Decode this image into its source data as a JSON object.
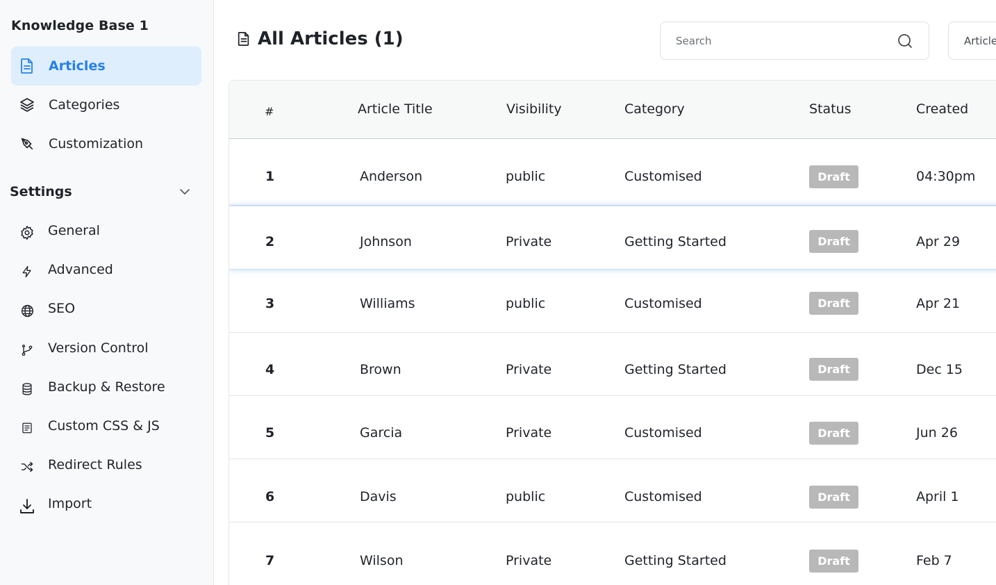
{
  "sidebar": {
    "kb_title": "Knowledge Base 1",
    "nav": [
      {
        "label": "Articles",
        "icon": "document-icon",
        "active": true
      },
      {
        "label": "Categories",
        "icon": "layers-icon",
        "active": false
      },
      {
        "label": "Customization",
        "icon": "pen-tool-icon",
        "active": false
      }
    ],
    "settings_label": "Settings",
    "settings_items": [
      {
        "label": "General",
        "icon": "gear-icon"
      },
      {
        "label": "Advanced",
        "icon": "lightning-icon"
      },
      {
        "label": "SEO",
        "icon": "globe-icon"
      },
      {
        "label": "Version Control",
        "icon": "git-branch-icon"
      },
      {
        "label": "Backup & Restore",
        "icon": "database-icon"
      },
      {
        "label": "Custom CSS & JS",
        "icon": "code-file-icon"
      },
      {
        "label": "Redirect Rules",
        "icon": "shuffle-icon"
      },
      {
        "label": "Import",
        "icon": "download-icon"
      }
    ]
  },
  "header": {
    "title": "All Articles (1)",
    "search_placeholder": "Search",
    "article_button_label": "Article"
  },
  "table": {
    "columns": [
      "#",
      "Article Title",
      "Visibility",
      "Category",
      "Status",
      "Created"
    ],
    "rows": [
      {
        "num": "1",
        "title": "Anderson",
        "visibility": "public",
        "category": "Customised",
        "status": "Draft",
        "created": "04:30pm"
      },
      {
        "num": "2",
        "title": "Johnson",
        "visibility": "Private",
        "category": "Getting Started",
        "status": "Draft",
        "created": "Apr 29"
      },
      {
        "num": "3",
        "title": "Williams",
        "visibility": "public",
        "category": "Customised",
        "status": "Draft",
        "created": "Apr 21"
      },
      {
        "num": "4",
        "title": "Brown",
        "visibility": "Private",
        "category": "Getting Started",
        "status": "Draft",
        "created": "Dec 15"
      },
      {
        "num": "5",
        "title": "Garcia",
        "visibility": "Private",
        "category": "Customised",
        "status": "Draft",
        "created": "Jun 26"
      },
      {
        "num": "6",
        "title": "Davis",
        "visibility": "public",
        "category": "Customised",
        "status": "Draft",
        "created": "April 1"
      },
      {
        "num": "7",
        "title": "Wilson",
        "visibility": "Private",
        "category": "Getting Started",
        "status": "Draft",
        "created": "Feb 7"
      }
    ]
  },
  "colors": {
    "accent": "#2680e8",
    "active_bg": "#deeefc",
    "badge_bg": "#b8b8b8"
  }
}
